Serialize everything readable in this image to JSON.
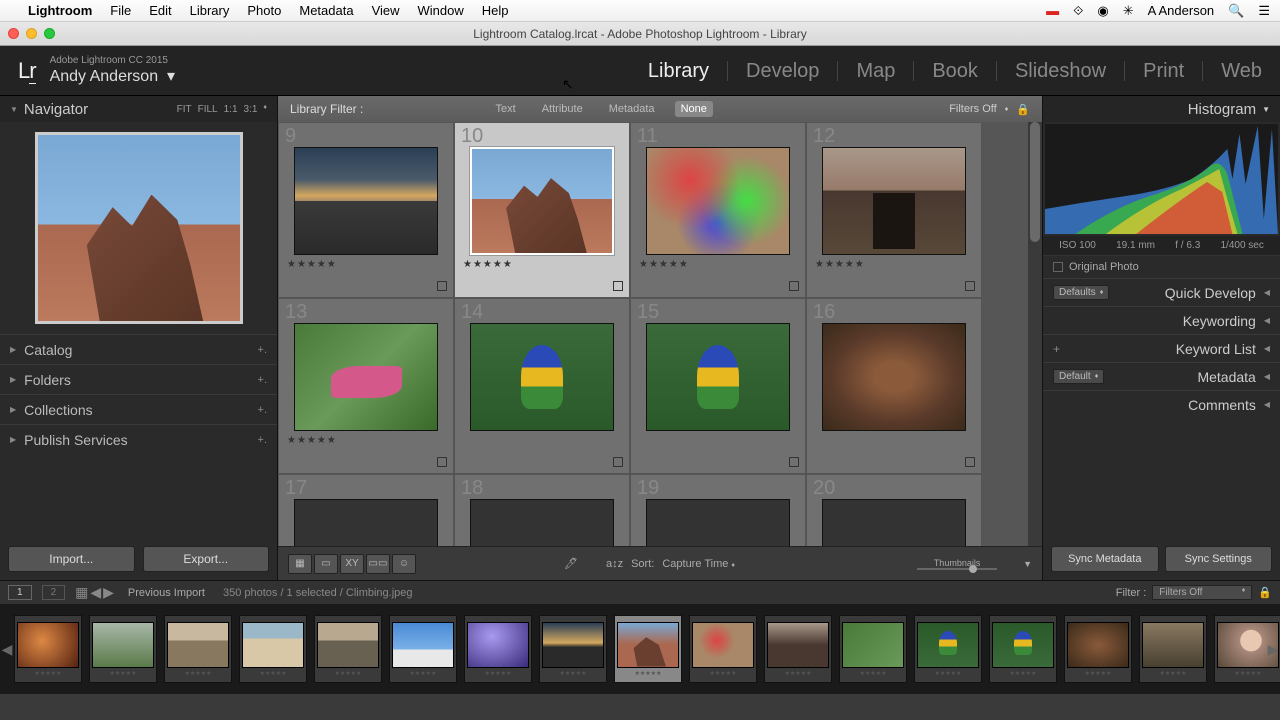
{
  "menubar": {
    "app": "Lightroom",
    "items": [
      "File",
      "Edit",
      "Library",
      "Photo",
      "Metadata",
      "View",
      "Window",
      "Help"
    ],
    "user": "A Anderson"
  },
  "titlebar": "Lightroom Catalog.lrcat - Adobe Photoshop Lightroom - Library",
  "identity": {
    "product": "Adobe Lightroom CC 2015",
    "name": "Andy Anderson"
  },
  "modules": [
    "Library",
    "Develop",
    "Map",
    "Book",
    "Slideshow",
    "Print",
    "Web"
  ],
  "active_module": "Library",
  "navigator": {
    "title": "Navigator",
    "zoom": [
      "FIT",
      "FILL",
      "1:1",
      "3:1"
    ]
  },
  "left_sections": [
    "Catalog",
    "Folders",
    "Collections",
    "Publish Services"
  ],
  "left_buttons": {
    "import": "Import...",
    "export": "Export..."
  },
  "filter": {
    "label": "Library Filter :",
    "tabs": [
      "Text",
      "Attribute",
      "Metadata",
      "None"
    ],
    "active": "None",
    "status": "Filters Off"
  },
  "grid_cells": [
    {
      "idx": "9",
      "type": "sunset",
      "stars": "★★★★★",
      "selected": false
    },
    {
      "idx": "10",
      "type": "rocks",
      "stars": "★★★★★",
      "selected": true
    },
    {
      "idx": "11",
      "type": "market",
      "stars": "★★★★★",
      "selected": false
    },
    {
      "idx": "12",
      "type": "building",
      "stars": "★★★★★",
      "selected": false
    },
    {
      "idx": "13",
      "type": "grasshopper",
      "stars": "★★★★★",
      "selected": false
    },
    {
      "idx": "14",
      "type": "parrot",
      "stars": "",
      "selected": false
    },
    {
      "idx": "15",
      "type": "parrot",
      "stars": "",
      "selected": false
    },
    {
      "idx": "16",
      "type": "orangutan",
      "stars": "",
      "selected": false
    },
    {
      "idx": "17",
      "type": "dark",
      "stars": "",
      "selected": false
    },
    {
      "idx": "18",
      "type": "dark",
      "stars": "",
      "selected": false
    },
    {
      "idx": "19",
      "type": "dark",
      "stars": "",
      "selected": false
    },
    {
      "idx": "20",
      "type": "dark",
      "stars": "",
      "selected": false
    }
  ],
  "toolbar": {
    "sort_label": "Sort:",
    "sort_value": "Capture Time",
    "thumbnails": "Thumbnails"
  },
  "histogram": {
    "title": "Histogram",
    "stats": [
      "ISO 100",
      "19.1 mm",
      "f / 6.3",
      "1/400 sec"
    ],
    "original": "Original Photo"
  },
  "right_sections": [
    {
      "label": "Quick Develop",
      "dropdown": "Defaults"
    },
    {
      "label": "Keywording"
    },
    {
      "label": "Keyword List",
      "plus": true
    },
    {
      "label": "Metadata",
      "dropdown": "Default"
    },
    {
      "label": "Comments"
    }
  ],
  "right_buttons": {
    "sync_meta": "Sync Metadata",
    "sync_settings": "Sync Settings"
  },
  "info": {
    "screens": [
      "1",
      "2"
    ],
    "source": "Previous Import",
    "count_text": "350 photos / 1 selected / Climbing.jpeg",
    "filter_label": "Filter :",
    "filter_value": "Filters Off"
  },
  "filmstrip_count": 17
}
